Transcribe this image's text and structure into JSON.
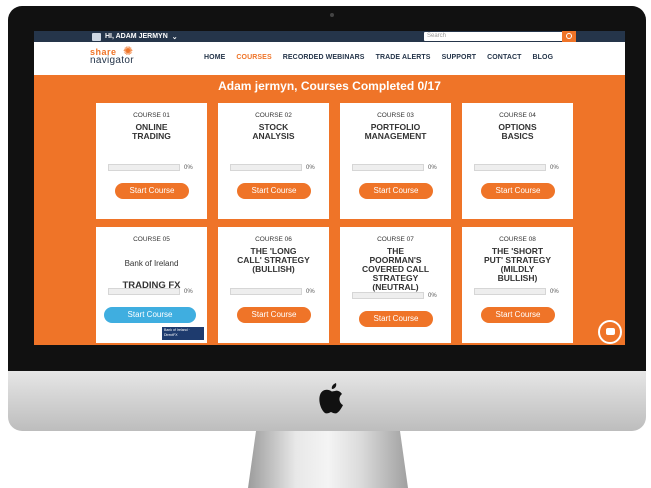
{
  "topbar": {
    "user_label": "HI, ADAM JERMYN",
    "caret": "⌄",
    "search_placeholder": "Search"
  },
  "logo": {
    "line1": "share",
    "line2": "navigator"
  },
  "nav": {
    "items": [
      "HOME",
      "COURSES",
      "RECORDED WEBINARS",
      "TRADE ALERTS",
      "SUPPORT",
      "CONTACT",
      "BLOG"
    ],
    "active": "COURSES"
  },
  "heading": "Adam jermyn, Courses Completed 0/17",
  "courses": [
    {
      "number": "COURSE 01",
      "title": "ONLINE\nTRADING",
      "percent": "0%",
      "button": "Start Course"
    },
    {
      "number": "COURSE 02",
      "title": "STOCK\nANALYSIS",
      "percent": "0%",
      "button": "Start Course"
    },
    {
      "number": "COURSE 03",
      "title": "PORTFOLIO\nMANAGEMENT",
      "percent": "0%",
      "button": "Start Course"
    },
    {
      "number": "COURSE 04",
      "title": "OPTIONS\nBASICS",
      "percent": "0%",
      "button": "Start Course"
    },
    {
      "number": "COURSE 05",
      "title_line1": "Bank of Ireland",
      "title_line2": "TRADING FX",
      "percent": "0%",
      "button": "Start Course",
      "sponsor": "Bank of Ireland  · DirectFX"
    },
    {
      "number": "COURSE 06",
      "title": "THE 'LONG\nCALL' STRATEGY\n(BULLISH)",
      "percent": "0%",
      "button": "Start Course"
    },
    {
      "number": "COURSE 07",
      "title": "THE\nPOORMAN'S\nCOVERED CALL\nSTRATEGY\n(NEUTRAL)",
      "percent": "0%",
      "button": "Start Course"
    },
    {
      "number": "COURSE 08",
      "title": "THE 'SHORT\nPUT' STRATEGY\n(MILDLY\nBULLISH)",
      "percent": "0%",
      "button": "Start Course"
    }
  ],
  "colors": {
    "accent": "#ef7428",
    "navy": "#25354a",
    "blue_button": "#3faee0"
  },
  "icons": {
    "chat": "chat-bubble-icon",
    "search": "search-icon",
    "device": "apple-logo-icon"
  }
}
